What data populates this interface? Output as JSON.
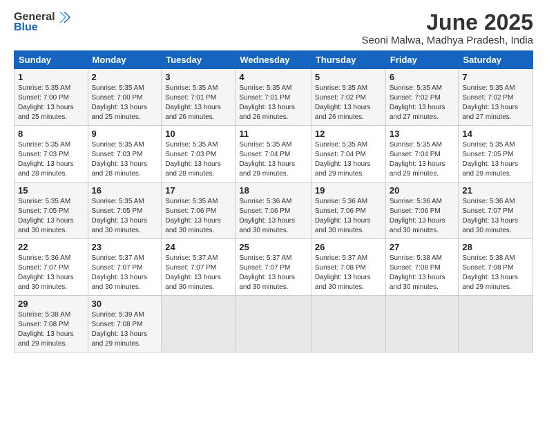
{
  "logo": {
    "general": "General",
    "blue": "Blue"
  },
  "title": "June 2025",
  "location": "Seoni Malwa, Madhya Pradesh, India",
  "days_of_week": [
    "Sunday",
    "Monday",
    "Tuesday",
    "Wednesday",
    "Thursday",
    "Friday",
    "Saturday"
  ],
  "weeks": [
    [
      {
        "day": "1",
        "sunrise": "5:35 AM",
        "sunset": "7:00 PM",
        "daylight": "13 hours and 25 minutes."
      },
      {
        "day": "2",
        "sunrise": "5:35 AM",
        "sunset": "7:00 PM",
        "daylight": "13 hours and 25 minutes."
      },
      {
        "day": "3",
        "sunrise": "5:35 AM",
        "sunset": "7:01 PM",
        "daylight": "13 hours and 26 minutes."
      },
      {
        "day": "4",
        "sunrise": "5:35 AM",
        "sunset": "7:01 PM",
        "daylight": "13 hours and 26 minutes."
      },
      {
        "day": "5",
        "sunrise": "5:35 AM",
        "sunset": "7:02 PM",
        "daylight": "13 hours and 26 minutes."
      },
      {
        "day": "6",
        "sunrise": "5:35 AM",
        "sunset": "7:02 PM",
        "daylight": "13 hours and 27 minutes."
      },
      {
        "day": "7",
        "sunrise": "5:35 AM",
        "sunset": "7:02 PM",
        "daylight": "13 hours and 27 minutes."
      }
    ],
    [
      {
        "day": "8",
        "sunrise": "5:35 AM",
        "sunset": "7:03 PM",
        "daylight": "13 hours and 28 minutes."
      },
      {
        "day": "9",
        "sunrise": "5:35 AM",
        "sunset": "7:03 PM",
        "daylight": "13 hours and 28 minutes."
      },
      {
        "day": "10",
        "sunrise": "5:35 AM",
        "sunset": "7:03 PM",
        "daylight": "13 hours and 28 minutes."
      },
      {
        "day": "11",
        "sunrise": "5:35 AM",
        "sunset": "7:04 PM",
        "daylight": "13 hours and 29 minutes."
      },
      {
        "day": "12",
        "sunrise": "5:35 AM",
        "sunset": "7:04 PM",
        "daylight": "13 hours and 29 minutes."
      },
      {
        "day": "13",
        "sunrise": "5:35 AM",
        "sunset": "7:04 PM",
        "daylight": "13 hours and 29 minutes."
      },
      {
        "day": "14",
        "sunrise": "5:35 AM",
        "sunset": "7:05 PM",
        "daylight": "13 hours and 29 minutes."
      }
    ],
    [
      {
        "day": "15",
        "sunrise": "5:35 AM",
        "sunset": "7:05 PM",
        "daylight": "13 hours and 30 minutes."
      },
      {
        "day": "16",
        "sunrise": "5:35 AM",
        "sunset": "7:05 PM",
        "daylight": "13 hours and 30 minutes."
      },
      {
        "day": "17",
        "sunrise": "5:35 AM",
        "sunset": "7:06 PM",
        "daylight": "13 hours and 30 minutes."
      },
      {
        "day": "18",
        "sunrise": "5:36 AM",
        "sunset": "7:06 PM",
        "daylight": "13 hours and 30 minutes."
      },
      {
        "day": "19",
        "sunrise": "5:36 AM",
        "sunset": "7:06 PM",
        "daylight": "13 hours and 30 minutes."
      },
      {
        "day": "20",
        "sunrise": "5:36 AM",
        "sunset": "7:06 PM",
        "daylight": "13 hours and 30 minutes."
      },
      {
        "day": "21",
        "sunrise": "5:36 AM",
        "sunset": "7:07 PM",
        "daylight": "13 hours and 30 minutes."
      }
    ],
    [
      {
        "day": "22",
        "sunrise": "5:36 AM",
        "sunset": "7:07 PM",
        "daylight": "13 hours and 30 minutes."
      },
      {
        "day": "23",
        "sunrise": "5:37 AM",
        "sunset": "7:07 PM",
        "daylight": "13 hours and 30 minutes."
      },
      {
        "day": "24",
        "sunrise": "5:37 AM",
        "sunset": "7:07 PM",
        "daylight": "13 hours and 30 minutes."
      },
      {
        "day": "25",
        "sunrise": "5:37 AM",
        "sunset": "7:07 PM",
        "daylight": "13 hours and 30 minutes."
      },
      {
        "day": "26",
        "sunrise": "5:37 AM",
        "sunset": "7:08 PM",
        "daylight": "13 hours and 30 minutes."
      },
      {
        "day": "27",
        "sunrise": "5:38 AM",
        "sunset": "7:08 PM",
        "daylight": "13 hours and 30 minutes."
      },
      {
        "day": "28",
        "sunrise": "5:38 AM",
        "sunset": "7:08 PM",
        "daylight": "13 hours and 29 minutes."
      }
    ],
    [
      {
        "day": "29",
        "sunrise": "5:38 AM",
        "sunset": "7:08 PM",
        "daylight": "13 hours and 29 minutes."
      },
      {
        "day": "30",
        "sunrise": "5:39 AM",
        "sunset": "7:08 PM",
        "daylight": "13 hours and 29 minutes."
      },
      null,
      null,
      null,
      null,
      null
    ]
  ]
}
